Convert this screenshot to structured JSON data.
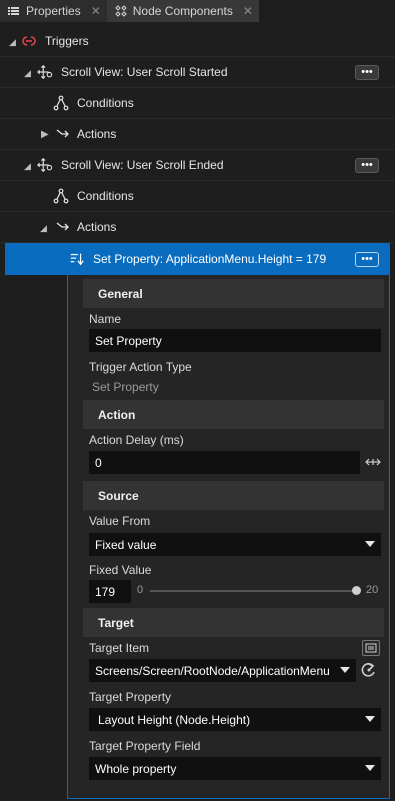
{
  "tabs": [
    {
      "label": "Properties",
      "icon": "list-icon",
      "active": false
    },
    {
      "label": "Node Components",
      "icon": "components-icon",
      "active": true
    }
  ],
  "tab_close_glyph": "✕",
  "tree": {
    "root": {
      "label": "Triggers",
      "icon": "triggers-icon"
    },
    "trigger1": {
      "label": "Scroll View: User Scroll Started",
      "icon": "trigger-icon",
      "conditions": "Conditions",
      "actions": "Actions"
    },
    "trigger2": {
      "label": "Scroll View: User Scroll Ended",
      "icon": "trigger-icon",
      "conditions": "Conditions",
      "actions": "Actions"
    },
    "selected_action": {
      "label": "Set Property: ApplicationMenu.Height = 179",
      "icon": "set-property-icon"
    },
    "more_label": "•••"
  },
  "properties": {
    "general": {
      "title": "General",
      "name_label": "Name",
      "name_value": "Set Property",
      "type_label": "Trigger Action Type",
      "type_value": "Set Property"
    },
    "action": {
      "title": "Action",
      "delay_label": "Action Delay (ms)",
      "delay_value": "0"
    },
    "source": {
      "title": "Source",
      "value_from_label": "Value From",
      "value_from_value": "Fixed value",
      "fixed_value_label": "Fixed Value",
      "fixed_value": "179",
      "slider_min": "0",
      "slider_max": "20",
      "slider_fraction": 1.0
    },
    "target": {
      "title": "Target",
      "item_label": "Target Item",
      "item_value": "Screens/Screen/RootNode/ApplicationMenu",
      "property_label": "Target Property",
      "property_value": "Layout Height (Node.Height)",
      "field_label": "Target Property Field",
      "field_value": "Whole property"
    }
  },
  "colors": {
    "accent": "#0a6cbf",
    "trigger_red": "#e0444e"
  }
}
